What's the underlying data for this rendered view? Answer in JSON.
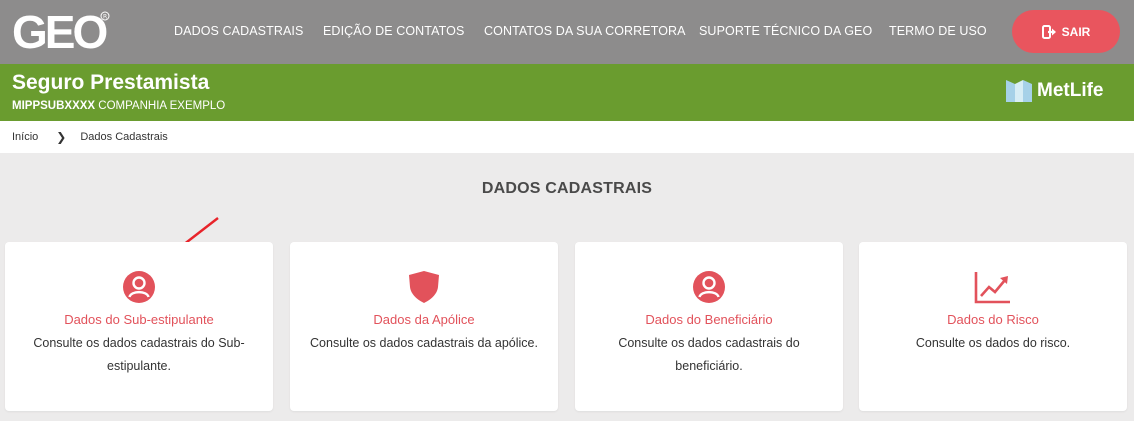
{
  "header": {
    "logo_text": "GEO",
    "nav": [
      "DADOS CADASTRAIS",
      "EDIÇÃO DE CONTATOS",
      "CONTATOS DA SUA CORRETORA",
      "SUPORTE TÉCNICO DA GEO",
      "TERMO DE USO"
    ],
    "logout_label": "SAIR"
  },
  "banner": {
    "title": "Seguro Prestamista",
    "code": "MIPPSUBXXXX",
    "company": "COMPANHIA EXEMPLO",
    "brand": "MetLife"
  },
  "breadcrumb": {
    "home": "Início",
    "current": "Dados Cadastrais"
  },
  "section": {
    "title": "DADOS CADASTRAIS"
  },
  "cards": [
    {
      "title": "Dados do Sub-estipulante",
      "desc": "Consulte os dados cadastrais do Sub-estipulante.",
      "icon": "user-circle-icon"
    },
    {
      "title": "Dados da Apólice",
      "desc": "Consulte os dados cadastrais da apólice.",
      "icon": "shield-icon"
    },
    {
      "title": "Dados do Beneficiário",
      "desc": "Consulte os dados cadastrais do beneficiário.",
      "icon": "user-circle-icon"
    },
    {
      "title": "Dados do Risco",
      "desc": "Consulte os dados do risco.",
      "icon": "trend-chart-icon"
    }
  ],
  "colors": {
    "accent": "#e2525b",
    "banner": "#6a9c2f",
    "topbar": "#8d8c8c",
    "logout": "#e9555e"
  }
}
